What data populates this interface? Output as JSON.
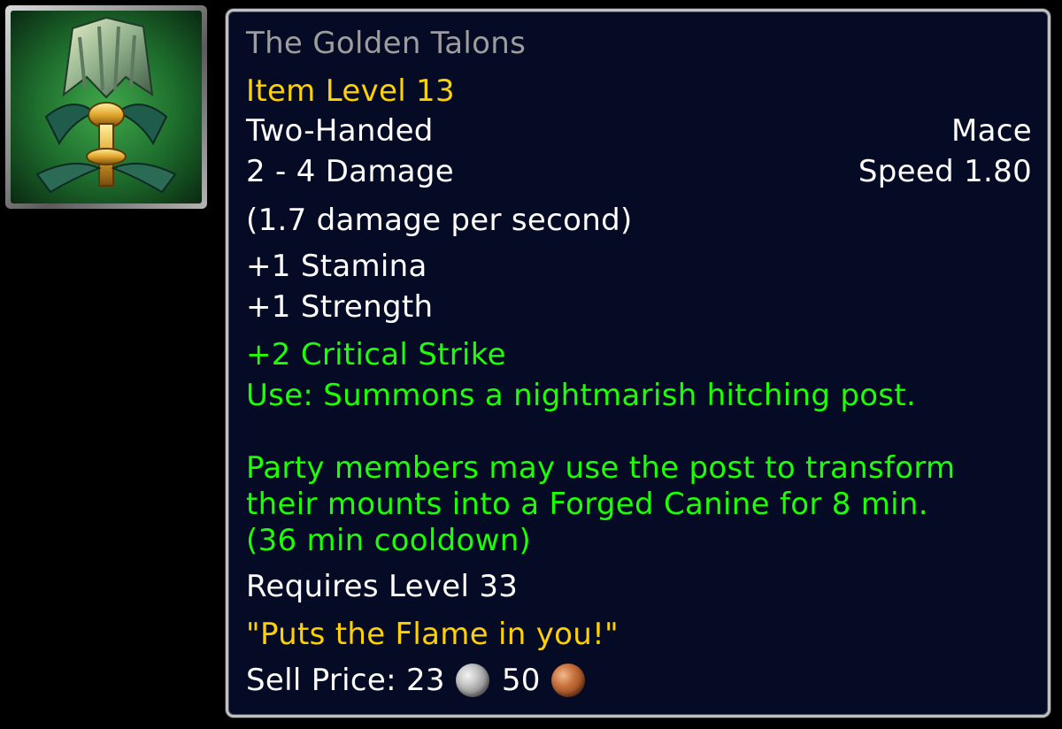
{
  "item": {
    "icon": "golden-talons-mace-icon",
    "name": "The Golden Talons",
    "item_level": "Item Level 13",
    "hand": "Two-Handed",
    "type": "Mace",
    "damage": "2 - 4 Damage",
    "speed": "Speed 1.80",
    "dps": "(1.7 damage per second)",
    "stats": [
      "+1 Stamina",
      "+1 Strength"
    ],
    "green_stat": "+2 Critical Strike",
    "use_text": "Use: Summons a nightmarish hitching post.",
    "effect_lines": [
      "Party members may use the post to transform",
      "their mounts into a Forged Canine for 8 min.",
      "(36 min cooldown)"
    ],
    "requires": "Requires Level 33",
    "flavor": "\"Puts the Flame in you!\"",
    "sell": {
      "label": "Sell Price: 23",
      "silver_icon": "silver-coin-icon",
      "copper": "50",
      "copper_icon": "copper-coin-icon"
    }
  },
  "colors": {
    "name_poor": "#9d9d9d",
    "item_level": "#ffd100",
    "white": "#ffffff",
    "green": "#1eff00",
    "tooltip_bg": "#060b25",
    "tooltip_border": "#bfc0c4"
  }
}
